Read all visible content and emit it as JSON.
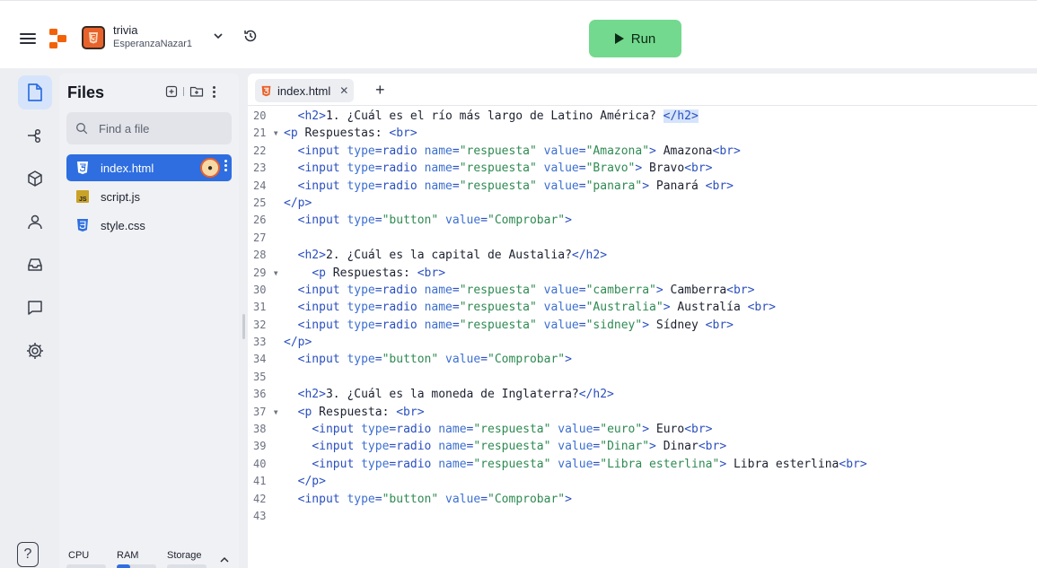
{
  "header": {
    "repl_name": "trivia",
    "repl_owner": "EsperanzaNazar1",
    "run_label": "Run"
  },
  "files": {
    "title": "Files",
    "search_placeholder": "Find a file",
    "items": [
      {
        "name": "index.html",
        "icon": "html5-icon"
      },
      {
        "name": "script.js",
        "icon": "js-icon"
      },
      {
        "name": "style.css",
        "icon": "css3-icon"
      }
    ],
    "resources": {
      "cpu_label": "CPU",
      "ram_label": "RAM",
      "storage_label": "Storage",
      "cpu_fraction": 0.0,
      "ram_fraction": 0.35,
      "storage_fraction": 0.0
    }
  },
  "editor": {
    "tab_label": "index.html",
    "lines": [
      {
        "n": "20",
        "fold": false,
        "indent": "  ",
        "parts": [
          [
            "tag",
            "<h2>"
          ],
          [
            "txt",
            "1. ¿Cuál es el río más largo de Latino América? "
          ],
          [
            "sel",
            "</h2>"
          ]
        ]
      },
      {
        "n": "21",
        "fold": true,
        "indent": "",
        "parts": [
          [
            "tag",
            "<p"
          ],
          [
            "txt",
            " Respuestas: "
          ],
          [
            "tag",
            "<br>"
          ]
        ]
      },
      {
        "n": "22",
        "fold": false,
        "indent": "  ",
        "parts": [
          [
            "tag",
            "<input "
          ],
          [
            "attr",
            "type"
          ],
          [
            "tag",
            "=radio "
          ],
          [
            "attr",
            "name"
          ],
          [
            "tag",
            "="
          ],
          [
            "str",
            "\"respuesta\""
          ],
          [
            "tag",
            " "
          ],
          [
            "attr",
            "value"
          ],
          [
            "tag",
            "="
          ],
          [
            "str",
            "\"Amazona\""
          ],
          [
            "tag",
            ">"
          ],
          [
            "txt",
            " Amazona"
          ],
          [
            "tag",
            "<br>"
          ]
        ]
      },
      {
        "n": "23",
        "fold": false,
        "indent": "  ",
        "parts": [
          [
            "tag",
            "<input "
          ],
          [
            "attr",
            "type"
          ],
          [
            "tag",
            "=radio "
          ],
          [
            "attr",
            "name"
          ],
          [
            "tag",
            "="
          ],
          [
            "str",
            "\"respuesta\""
          ],
          [
            "tag",
            " "
          ],
          [
            "attr",
            "value"
          ],
          [
            "tag",
            "="
          ],
          [
            "str",
            "\"Bravo\""
          ],
          [
            "tag",
            ">"
          ],
          [
            "txt",
            " Bravo"
          ],
          [
            "tag",
            "<br>"
          ]
        ]
      },
      {
        "n": "24",
        "fold": false,
        "indent": "  ",
        "parts": [
          [
            "tag",
            "<input "
          ],
          [
            "attr",
            "type"
          ],
          [
            "tag",
            "=radio "
          ],
          [
            "attr",
            "name"
          ],
          [
            "tag",
            "="
          ],
          [
            "str",
            "\"respuesta\""
          ],
          [
            "tag",
            " "
          ],
          [
            "attr",
            "value"
          ],
          [
            "tag",
            "="
          ],
          [
            "str",
            "\"panara\""
          ],
          [
            "tag",
            ">"
          ],
          [
            "txt",
            " Panará "
          ],
          [
            "tag",
            "<br>"
          ]
        ]
      },
      {
        "n": "25",
        "fold": false,
        "indent": "",
        "parts": [
          [
            "tag",
            "</p>"
          ]
        ]
      },
      {
        "n": "26",
        "fold": false,
        "indent": "  ",
        "parts": [
          [
            "tag",
            "<input "
          ],
          [
            "attr",
            "type"
          ],
          [
            "tag",
            "="
          ],
          [
            "str",
            "\"button\""
          ],
          [
            "tag",
            " "
          ],
          [
            "attr",
            "value"
          ],
          [
            "tag",
            "="
          ],
          [
            "str",
            "\"Comprobar\""
          ],
          [
            "tag",
            ">"
          ]
        ]
      },
      {
        "n": "27",
        "fold": false,
        "indent": "",
        "parts": []
      },
      {
        "n": "28",
        "fold": false,
        "indent": "  ",
        "parts": [
          [
            "tag",
            "<h2>"
          ],
          [
            "txt",
            "2. ¿Cuál es la capital de Austalia?"
          ],
          [
            "tag",
            "</h2>"
          ]
        ]
      },
      {
        "n": "29",
        "fold": true,
        "indent": "    ",
        "parts": [
          [
            "tag",
            "<p"
          ],
          [
            "txt",
            " Respuestas: "
          ],
          [
            "tag",
            "<br>"
          ]
        ]
      },
      {
        "n": "30",
        "fold": false,
        "indent": "  ",
        "parts": [
          [
            "tag",
            "<input "
          ],
          [
            "attr",
            "type"
          ],
          [
            "tag",
            "=radio "
          ],
          [
            "attr",
            "name"
          ],
          [
            "tag",
            "="
          ],
          [
            "str",
            "\"respuesta\""
          ],
          [
            "tag",
            " "
          ],
          [
            "attr",
            "value"
          ],
          [
            "tag",
            "="
          ],
          [
            "str",
            "\"camberra\""
          ],
          [
            "tag",
            ">"
          ],
          [
            "txt",
            " Camberra"
          ],
          [
            "tag",
            "<br>"
          ]
        ]
      },
      {
        "n": "31",
        "fold": false,
        "indent": "  ",
        "parts": [
          [
            "tag",
            "<input "
          ],
          [
            "attr",
            "type"
          ],
          [
            "tag",
            "=radio "
          ],
          [
            "attr",
            "name"
          ],
          [
            "tag",
            "="
          ],
          [
            "str",
            "\"respuesta\""
          ],
          [
            "tag",
            " "
          ],
          [
            "attr",
            "value"
          ],
          [
            "tag",
            "="
          ],
          [
            "str",
            "\"Australia\""
          ],
          [
            "tag",
            ">"
          ],
          [
            "txt",
            " Australía "
          ],
          [
            "tag",
            "<br>"
          ]
        ]
      },
      {
        "n": "32",
        "fold": false,
        "indent": "  ",
        "parts": [
          [
            "tag",
            "<input "
          ],
          [
            "attr",
            "type"
          ],
          [
            "tag",
            "=radio "
          ],
          [
            "attr",
            "name"
          ],
          [
            "tag",
            "="
          ],
          [
            "str",
            "\"respuesta\""
          ],
          [
            "tag",
            " "
          ],
          [
            "attr",
            "value"
          ],
          [
            "tag",
            "="
          ],
          [
            "str",
            "\"sidney\""
          ],
          [
            "tag",
            ">"
          ],
          [
            "txt",
            " Sídney "
          ],
          [
            "tag",
            "<br>"
          ]
        ]
      },
      {
        "n": "33",
        "fold": false,
        "indent": "",
        "parts": [
          [
            "tag",
            "</p>"
          ]
        ]
      },
      {
        "n": "34",
        "fold": false,
        "indent": "  ",
        "parts": [
          [
            "tag",
            "<input "
          ],
          [
            "attr",
            "type"
          ],
          [
            "tag",
            "="
          ],
          [
            "str",
            "\"button\""
          ],
          [
            "tag",
            " "
          ],
          [
            "attr",
            "value"
          ],
          [
            "tag",
            "="
          ],
          [
            "str",
            "\"Comprobar\""
          ],
          [
            "tag",
            ">"
          ]
        ]
      },
      {
        "n": "35",
        "fold": false,
        "indent": "",
        "parts": []
      },
      {
        "n": "36",
        "fold": false,
        "indent": "  ",
        "parts": [
          [
            "tag",
            "<h2>"
          ],
          [
            "txt",
            "3. ¿Cuál es la moneda de Inglaterra?"
          ],
          [
            "tag",
            "</h2>"
          ]
        ]
      },
      {
        "n": "37",
        "fold": true,
        "indent": "  ",
        "parts": [
          [
            "tag",
            "<p"
          ],
          [
            "txt",
            " Respuesta: "
          ],
          [
            "tag",
            "<br>"
          ]
        ]
      },
      {
        "n": "38",
        "fold": false,
        "indent": "    ",
        "parts": [
          [
            "tag",
            "<input "
          ],
          [
            "attr",
            "type"
          ],
          [
            "tag",
            "=radio "
          ],
          [
            "attr",
            "name"
          ],
          [
            "tag",
            "="
          ],
          [
            "str",
            "\"respuesta\""
          ],
          [
            "tag",
            " "
          ],
          [
            "attr",
            "value"
          ],
          [
            "tag",
            "="
          ],
          [
            "str",
            "\"euro\""
          ],
          [
            "tag",
            ">"
          ],
          [
            "txt",
            " Euro"
          ],
          [
            "tag",
            "<br>"
          ]
        ]
      },
      {
        "n": "39",
        "fold": false,
        "indent": "    ",
        "parts": [
          [
            "tag",
            "<input "
          ],
          [
            "attr",
            "type"
          ],
          [
            "tag",
            "=radio "
          ],
          [
            "attr",
            "name"
          ],
          [
            "tag",
            "="
          ],
          [
            "str",
            "\"respuesta\""
          ],
          [
            "tag",
            " "
          ],
          [
            "attr",
            "value"
          ],
          [
            "tag",
            "="
          ],
          [
            "str",
            "\"Dinar\""
          ],
          [
            "tag",
            ">"
          ],
          [
            "txt",
            " Dinar"
          ],
          [
            "tag",
            "<br>"
          ]
        ]
      },
      {
        "n": "40",
        "fold": false,
        "indent": "    ",
        "parts": [
          [
            "tag",
            "<input "
          ],
          [
            "attr",
            "type"
          ],
          [
            "tag",
            "=radio "
          ],
          [
            "attr",
            "name"
          ],
          [
            "tag",
            "="
          ],
          [
            "str",
            "\"respuesta\""
          ],
          [
            "tag",
            " "
          ],
          [
            "attr",
            "value"
          ],
          [
            "tag",
            "="
          ],
          [
            "str",
            "\"Libra esterlina\""
          ],
          [
            "tag",
            ">"
          ],
          [
            "txt",
            " Libra esterlina"
          ],
          [
            "tag",
            "<br>"
          ]
        ]
      },
      {
        "n": "41",
        "fold": false,
        "indent": "  ",
        "parts": [
          [
            "tag",
            "</p>"
          ]
        ]
      },
      {
        "n": "42",
        "fold": false,
        "indent": "  ",
        "parts": [
          [
            "tag",
            "<input "
          ],
          [
            "attr",
            "type"
          ],
          [
            "tag",
            "="
          ],
          [
            "str",
            "\"button\""
          ],
          [
            "tag",
            " "
          ],
          [
            "attr",
            "value"
          ],
          [
            "tag",
            "="
          ],
          [
            "str",
            "\"Comprobar\""
          ],
          [
            "tag",
            ">"
          ]
        ]
      },
      {
        "n": "43",
        "fold": false,
        "indent": "",
        "parts": []
      }
    ]
  },
  "colors": {
    "run_button": "#73d98e",
    "active_file": "#2e6ee0",
    "html_orange": "#e8622c"
  }
}
